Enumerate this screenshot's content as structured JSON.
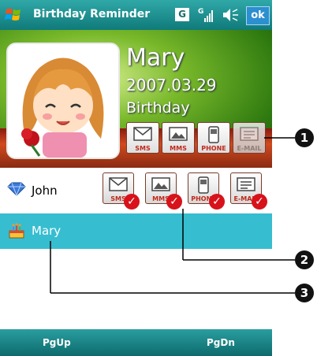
{
  "titlebar": {
    "title": "Birthday Reminder",
    "g_label": "G",
    "ok_label": "ok"
  },
  "contact": {
    "name": "Mary",
    "date": "2007.03.29",
    "occasion": "Birthday"
  },
  "contact_buttons": {
    "sms": "SMS",
    "mms": "MMS",
    "phone": "PHONE",
    "email": "E-MAIL"
  },
  "list": [
    {
      "name": "John",
      "actions": [
        "SMS",
        "MMS",
        "PHONE",
        "E-MAIL"
      ]
    },
    {
      "name": "Mary"
    }
  ],
  "bottombar": {
    "pgup": "PgUp",
    "pgdn": "PgDn"
  },
  "callouts": [
    "1",
    "2",
    "3"
  ],
  "colors": {
    "titlebar": "#107a7a",
    "selected_row": "#37bdd0",
    "check": "#d8121a"
  }
}
